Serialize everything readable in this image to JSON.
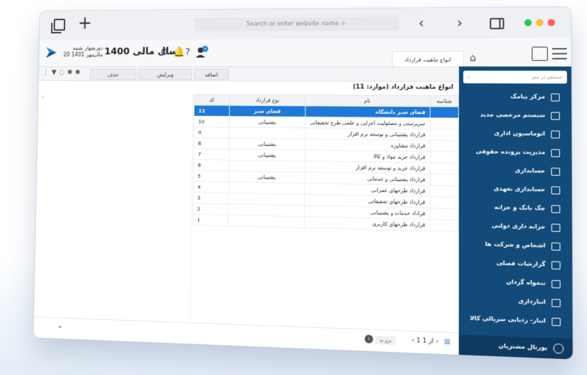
{
  "browser": {
    "address_placeholder": "Search or enter website name",
    "search_glyph": "⌕",
    "nav_glyphs": "‹ ›",
    "traffic_colors": [
      "#2ec551",
      "#ffbd2e",
      "#ff5f57"
    ]
  },
  "topbar": {
    "day": "چهار شنبه",
    "date": "20 مهر 1401",
    "period_top": "دوره",
    "period_bottom": "مالی",
    "fiscal_year": "سال مالی 1400",
    "tab_label": "انواع ماهیت قرارداد",
    "notification_count": "4"
  },
  "toolbar": {
    "add": "اضافه",
    "edit": "ویرایش",
    "delete": "حذف"
  },
  "grid": {
    "title": "انواع ماهیت قرارداد (موارد: 11)",
    "headers": {
      "code": "کد",
      "type": "نوع قرارداد",
      "name": "نام",
      "id": "شناسه"
    },
    "rows": [
      {
        "code": "11",
        "type": "فضای سبز",
        "name": "فضای سبز دانشگاه",
        "selected": true
      },
      {
        "code": "10",
        "type": "پشتیبانی",
        "name": "سرپرستی و مسئولیت اجرایی و علمی طرح تحقیقاتی"
      },
      {
        "code": "9",
        "type": "",
        "name": "قرارداد پشتیبانی و توسعه نرم افزار"
      },
      {
        "code": "8",
        "type": "پشتیبانی",
        "name": "قرارداد مشاوره"
      },
      {
        "code": "7",
        "type": "پشتیبانی",
        "name": "قرارداد خرید مواد و کالا"
      },
      {
        "code": "6",
        "type": "",
        "name": "قرارداد خرید و توسعه نرم افزار"
      },
      {
        "code": "5",
        "type": "پشتیبانی",
        "name": "قرارداد پشتیبانی و خدماتی"
      },
      {
        "code": "4",
        "type": "",
        "name": "قرارداد طرحهای عمرانی"
      },
      {
        "code": "3",
        "type": "",
        "name": "قرارداد طرحهای تحقیقاتی"
      },
      {
        "code": "2",
        "type": "",
        "name": "قراداد خدمات و پشتیبانی"
      },
      {
        "code": "1",
        "type": "",
        "name": "قرارداد طرحهای کاربری"
      }
    ]
  },
  "pager": {
    "text": "‹  1  از  1  ›",
    "go_label": "برو به"
  },
  "sidebar": {
    "search_placeholder": "جستجو در منو",
    "items": [
      "مرکز پیامک",
      "سیستم مرخصی جدید",
      "اتوماسیون اداری",
      "مدیریت پرونده حقوقی",
      "حسابداری",
      "حسابداری تعهدی",
      "چک بانک و خزانه",
      "خزانه داری دولتی",
      "اشخاص و شرکت ها",
      "گزارشات فصلی",
      "تنخواه گردان",
      "انبارداری",
      "انبار- ردیابی سریالی کالا"
    ],
    "portal": "پورتال مشتریان"
  },
  "colors": {
    "sidebar_bg": "#124a79",
    "selected_row": "#1e78d8"
  }
}
